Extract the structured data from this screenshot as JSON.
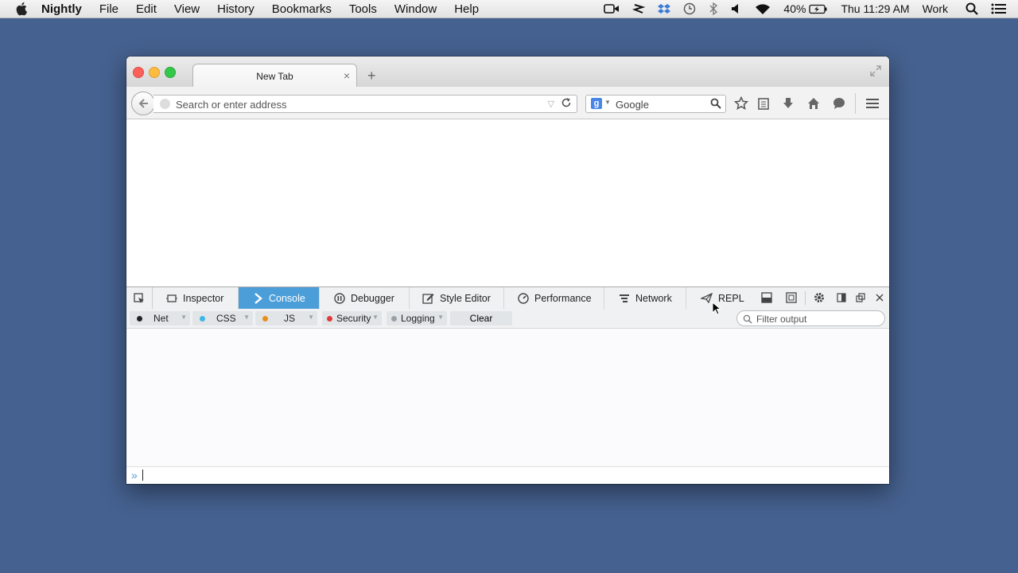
{
  "menubar": {
    "items": [
      "Nightly",
      "File",
      "Edit",
      "View",
      "History",
      "Bookmarks",
      "Tools",
      "Window",
      "Help"
    ],
    "battery": "40%",
    "clock": "Thu 11:29 AM",
    "user": "Work"
  },
  "browser": {
    "tab_title": "New Tab",
    "new_tab_label": "+",
    "tab_close": "×",
    "url_placeholder": "Search or enter address",
    "search_engine_letter": "g",
    "search_placeholder": "Google"
  },
  "devtools": {
    "tabs": [
      {
        "label": "Inspector",
        "icon": "inspector-icon"
      },
      {
        "label": "Console",
        "icon": "console-icon",
        "selected": true
      },
      {
        "label": "Debugger",
        "icon": "debugger-icon"
      },
      {
        "label": "Style Editor",
        "icon": "style-editor-icon"
      },
      {
        "label": "Performance",
        "icon": "performance-icon"
      },
      {
        "label": "Network",
        "icon": "network-icon"
      },
      {
        "label": "REPL",
        "icon": "repl-icon"
      }
    ],
    "filters": [
      {
        "label": "Net",
        "color": "#222222"
      },
      {
        "label": "CSS",
        "color": "#3fb5e6"
      },
      {
        "label": "JS",
        "color": "#e88e1a"
      },
      {
        "label": "Security",
        "color": "#e13a3a"
      },
      {
        "label": "Logging",
        "color": "#9aa0a6"
      }
    ],
    "clear_label": "Clear",
    "filter_placeholder": "Filter output",
    "prompt": "»"
  },
  "colors": {
    "desktop": "#45618f",
    "selected_tab": "#4c9ed9"
  }
}
